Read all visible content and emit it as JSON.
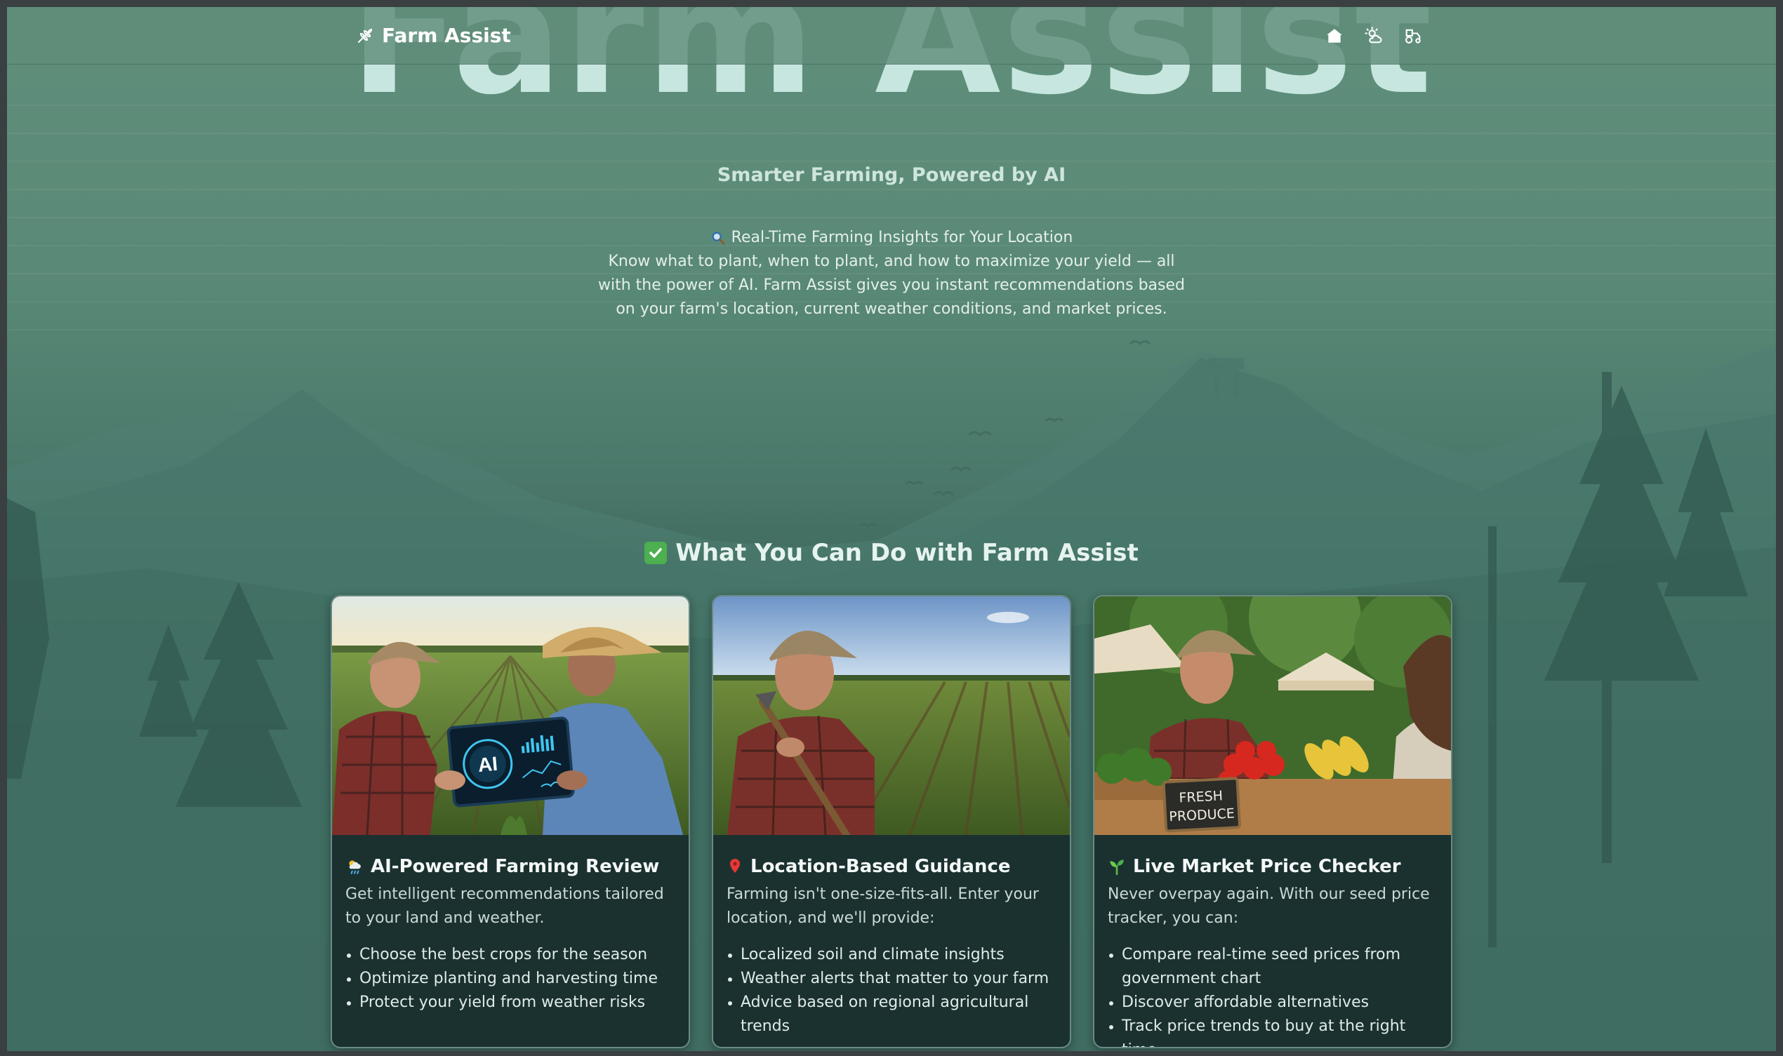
{
  "app": {
    "brand_name": "Farm Assist"
  },
  "nav": {
    "icons": [
      "home-icon",
      "weather-icon",
      "tractor-icon"
    ]
  },
  "hero": {
    "big_title": "Farm Assist",
    "subtitle": "Smarter Farming, Powered by AI",
    "insights_heading": "Real-Time Farming Insights for Your Location",
    "insights_text": "Know what to plant, when to plant, and how to maximize your yield — all with the power of AI. Farm Assist gives you instant recommendations based on your farm's location, current weather conditions, and market prices."
  },
  "features": {
    "title": "What You Can Do with Farm Assist",
    "cards": [
      {
        "title": "AI-Powered Farming Review",
        "description": "Get intelligent recommendations tailored to your land and weather.",
        "bullets": [
          "Choose the best crops for the season",
          "Optimize planting and harvesting time",
          "Protect your yield from weather risks"
        ],
        "image_overlay_text": "AI"
      },
      {
        "title": "Location-Based Guidance",
        "description": "Farming isn't one-size-fits-all. Enter your location, and we'll provide:",
        "bullets": [
          "Localized soil and climate insights",
          "Weather alerts that matter to your farm",
          "Advice based on regional agricultural trends"
        ]
      },
      {
        "title": "Live Market Price Checker",
        "description": "Never overpay again. With our seed price tracker, you can:",
        "bullets": [
          "Compare real-time seed prices from government chart",
          "Discover affordable alternatives",
          "Track price trends to buy at the right time"
        ],
        "image_overlay_text": "FRESH PRODUCE"
      }
    ]
  },
  "colors": {
    "background_top": "#5f8f7b",
    "background_bottom": "#243f3f",
    "card_bg": "#1a3130",
    "accent_green": "#4caf50",
    "hero_title": "#c6e6df"
  }
}
